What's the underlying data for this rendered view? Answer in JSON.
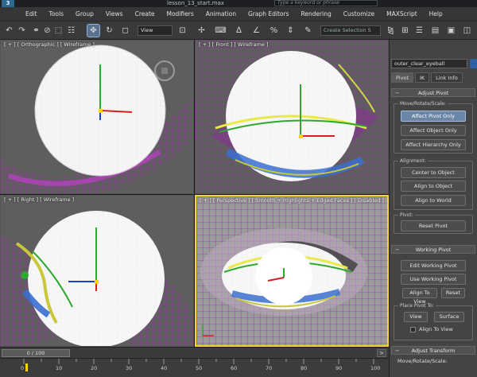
{
  "window": {
    "title": "lesson_13_start.max",
    "search_placeholder": "Type a keyword or phrase"
  },
  "app": {
    "logo_glyph": "3"
  },
  "menu": [
    "Edit",
    "Tools",
    "Group",
    "Views",
    "Create",
    "Modifiers",
    "Animation",
    "Graph Editors",
    "Rendering",
    "Customize",
    "MAXScript",
    "Help"
  ],
  "toolbar": {
    "view_dropdown": "View",
    "selection_set_placeholder": "Create Selection S",
    "icons": [
      "undo-icon",
      "redo-icon",
      "link-icon",
      "unlink-icon",
      "bind-spacewarp-icon",
      "selection-filter-icon",
      "select-object-icon",
      "select-by-name-icon",
      "rectangular-selection-icon",
      "window-crossing-icon",
      "select-and-move-icon",
      "select-and-rotate-icon",
      "select-and-scale-icon",
      "reference-coordinate-icon",
      "pivot-center-icon",
      "select-and-manipulate-icon",
      "keyboard-shortcut-icon",
      "snaps-toggle-icon",
      "angle-snap-icon",
      "percent-snap-icon",
      "spinner-snap-icon",
      "named-selection-icon",
      "mirror-icon",
      "align-icon",
      "layer-manager-icon",
      "graphite-tools-icon",
      "curve-editor-icon",
      "schematic-view-icon",
      "material-editor-icon",
      "render-setup-icon",
      "rendered-frame-icon",
      "render-icon"
    ]
  },
  "viewports": {
    "top_left": {
      "label": "[ + ] [ Orthographic ] [ Wireframe ]"
    },
    "top_right": {
      "label": "[ + ] [ Front ] [ Wireframe ]"
    },
    "bottom_left": {
      "label": "[ + ] [ Right ] [ Wireframe ]"
    },
    "bottom_right": {
      "label": "[ + ] [ Perspective ] [ Smooth + Highlights + Edged Faces ] [ Disabled ]"
    }
  },
  "command_panel": {
    "object_name": "outer_clear_eyeball",
    "object_color": "#2f5fa5",
    "tabs": [
      "Pivot",
      "IK",
      "Link Info"
    ],
    "adjust_pivot": {
      "title": "Adjust Pivot",
      "move_group_label": "Move/Rotate/Scale:",
      "affect_pivot_only": "Affect Pivot Only",
      "affect_object_only": "Affect Object Only",
      "affect_hierarchy_only": "Affect Hierarchy Only",
      "alignment_label": "Alignment:",
      "center_to_object": "Center to Object",
      "align_to_object": "Align to Object",
      "align_to_world": "Align to World",
      "pivot_label": "Pivot:",
      "reset_pivot": "Reset Pivot"
    },
    "working_pivot": {
      "title": "Working Pivot",
      "edit_working_pivot": "Edit Working Pivot",
      "use_working_pivot": "Use Working Pivot",
      "align_to_view": "Align To View",
      "reset": "Reset",
      "place_pivot_to_label": "Place Pivot To:",
      "view": "View",
      "surface": "Surface",
      "align_to_view_checkbox": "Align To View"
    },
    "adjust_transform": {
      "title": "Adjust Transform",
      "move_group_label": "Move/Rotate/Scale:"
    }
  },
  "timeline": {
    "slider_label": "0 / 100",
    "next_glyph": ">",
    "ticks": [
      0,
      10,
      20,
      30,
      40,
      50,
      60,
      70,
      80,
      90,
      100
    ]
  }
}
